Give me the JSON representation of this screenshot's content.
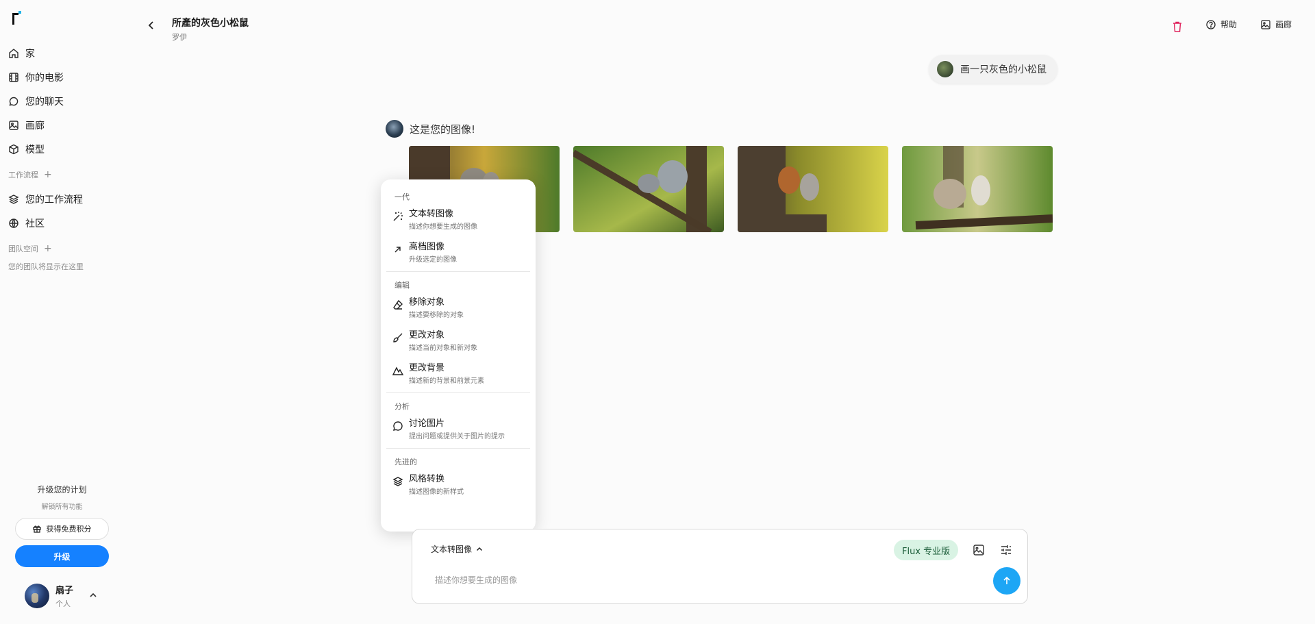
{
  "sidebar": {
    "items": [
      {
        "label": "家",
        "icon": "home-icon"
      },
      {
        "label": "你的电影",
        "icon": "film-icon"
      },
      {
        "label": "您的聊天",
        "icon": "chat-icon"
      },
      {
        "label": "画廊",
        "icon": "image-icon"
      },
      {
        "label": "模型",
        "icon": "cube-icon"
      }
    ],
    "workflow_label": "工作流程",
    "workflow_items": [
      {
        "label": "您的工作流程",
        "icon": "layers-icon"
      },
      {
        "label": "社区",
        "icon": "globe-icon"
      }
    ],
    "team_label": "团队空间",
    "team_empty": "您的团队将显示在这里"
  },
  "upgrade": {
    "title": "升级您的计划",
    "subtitle": "解锁所有功能",
    "credits_button": "获得免费积分",
    "upgrade_button": "升级"
  },
  "user": {
    "name": "扇子",
    "role": "个人"
  },
  "header": {
    "title": "所產的灰色小松鼠",
    "subtitle": "罗伊",
    "help_label": "帮助",
    "gallery_label": "画廊"
  },
  "chat": {
    "user_message": "画一只灰色的小松鼠",
    "bot_message": "这是您的图像!"
  },
  "menu": {
    "sections": [
      {
        "label": "一代",
        "items": [
          {
            "title": "文本转图像",
            "desc": "描述你想要生成的图像",
            "icon": "magic-wand-icon"
          },
          {
            "title": "高档图像",
            "desc": "升级选定的图像",
            "icon": "arrow-up-right-icon"
          }
        ]
      },
      {
        "label": "编辑",
        "items": [
          {
            "title": "移除对象",
            "desc": "描述要移除的对象",
            "icon": "eraser-icon"
          },
          {
            "title": "更改对象",
            "desc": "描述当前对象和新对象",
            "icon": "brush-icon"
          },
          {
            "title": "更改背景",
            "desc": "描述新的背景和前景元素",
            "icon": "mountain-icon"
          }
        ]
      },
      {
        "label": "分析",
        "items": [
          {
            "title": "讨论图片",
            "desc": "提出问题或提供关于图片的提示",
            "icon": "chat-icon"
          }
        ]
      },
      {
        "label": "先进的",
        "items": [
          {
            "title": "风格转换",
            "desc": "描述图像的新样式",
            "icon": "layers-icon"
          }
        ]
      }
    ]
  },
  "composer": {
    "mode": "文本转图像",
    "model": "Flux 专业版",
    "placeholder": "描述你想要生成的图像"
  },
  "colors": {
    "accent": "#1581ff",
    "send": "#1da6f5",
    "model_tag_bg": "#d9f3e4",
    "delete": "#e0245e"
  }
}
